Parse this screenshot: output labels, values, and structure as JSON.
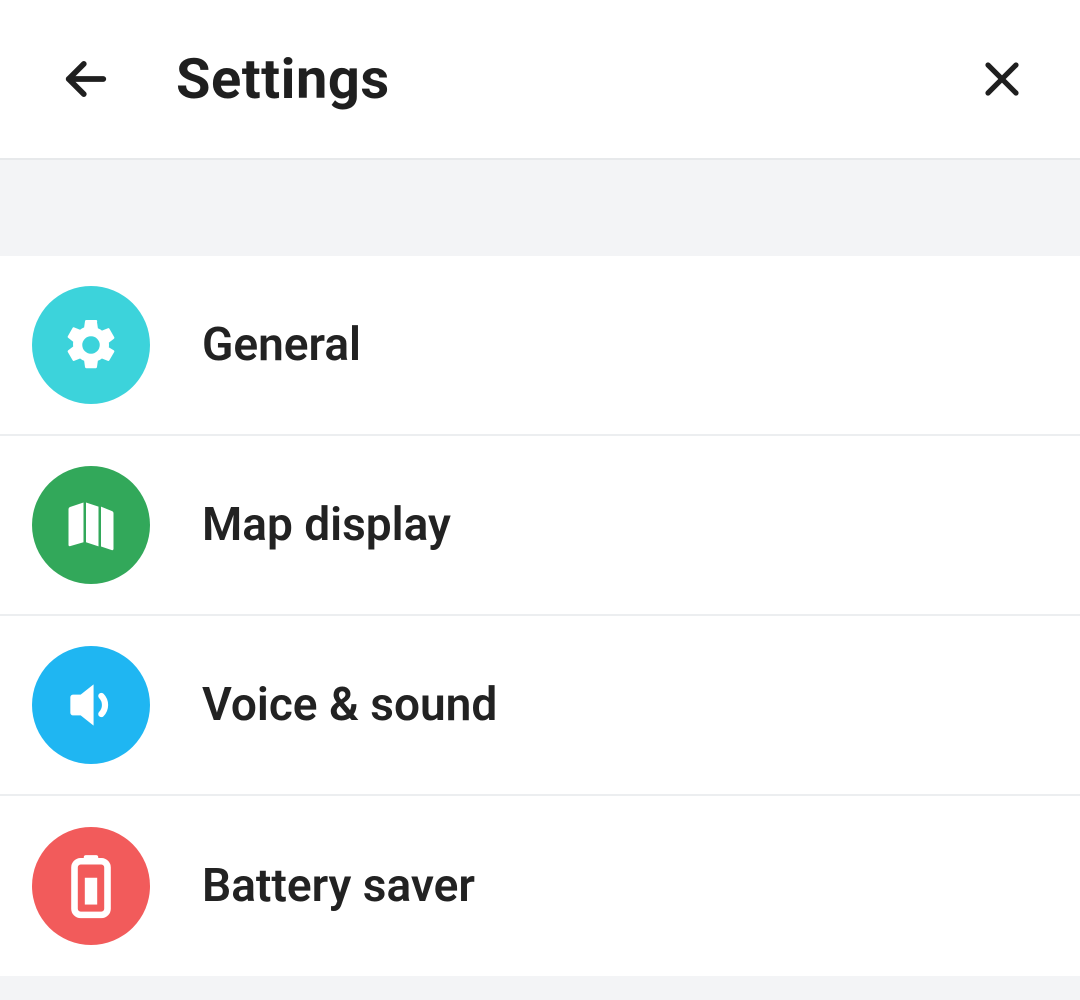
{
  "header": {
    "title": "Settings"
  },
  "items": [
    {
      "label": "General",
      "icon": "gear-icon",
      "color": "teal"
    },
    {
      "label": "Map display",
      "icon": "map-icon",
      "color": "green"
    },
    {
      "label": "Voice & sound",
      "icon": "speaker-icon",
      "color": "blue"
    },
    {
      "label": "Battery saver",
      "icon": "battery-icon",
      "color": "red"
    }
  ]
}
